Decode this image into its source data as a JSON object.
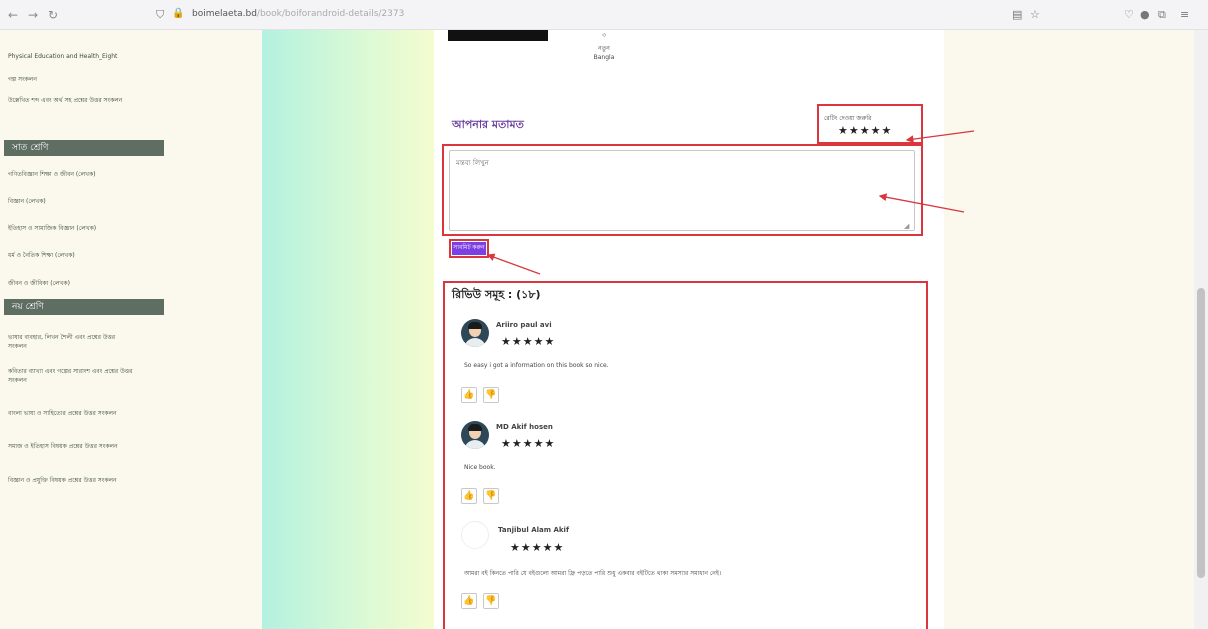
{
  "browser": {
    "back": "←",
    "forward": "→",
    "reload": "↻",
    "shield": "⛉",
    "lock": "🔒",
    "url_host": "boimelaeta.bd",
    "url_path": "/book/boiforandroid-details/2373",
    "reader_icon": "▤",
    "star_icon": "☆",
    "pocket_icon": "♡",
    "account_icon": "●",
    "extensions_icon": "⧉",
    "menu_icon": "≡"
  },
  "sidebar": {
    "items_top": [
      "Physical Education and Health_Eight",
      "গল্প সংকলন",
      "উল্লেখিত শব্দ এবং অর্থ সহ প্রশ্নের উত্তর সংকলন"
    ],
    "heading1": "সাত শ্রেণি",
    "items_mid": [
      "গণিতবিজ্ঞান শিক্ষা ও জীবন (লেখক)",
      "বিজ্ঞান (লেখক)",
      "ইতিহাস ও সামাজিক বিজ্ঞান (লেখক)",
      "ধর্ম ও নৈতিক শিক্ষা (লেখক)",
      "জীবন ও জীবিকা (লেখক)"
    ],
    "heading2": "নয় শ্রেণি",
    "items_bottom": [
      "ভাষার ব্যবহার, লিখন শৈলী এবং প্রশ্নের উত্তর সংকলন",
      "কবিতার ব্যাখ্যা এবং গল্পের সারাংশ এবং প্রশ্নের উত্তর সংকলন",
      "বাংলা ভাষা ও সাহিত্যের প্রশ্নের উত্তর সংকলন",
      "সমাজ ও ইতিহাস বিষয়ক প্রশ্নের উত্তর সংকলন",
      "বিজ্ঞান ও প্রযুক্তি বিষয়ক প্রশ্নের উত্তর সংকলন"
    ]
  },
  "book_meta": {
    "line1": "৩",
    "line2": "নতুন",
    "line3": "Bangla"
  },
  "review_form": {
    "title": "আপনার মতামত",
    "rate_label": "রেটিং দেওয়া জরুরি",
    "stars": "★★★★★",
    "placeholder": "মন্তব্য লিখুন",
    "resize_grip": "◢",
    "submit_label": "সাবমিট করুন"
  },
  "reviews": {
    "heading": "রিভিউ সমূহ : (১৮)",
    "thumb_up": "👍",
    "thumb_down": "👎",
    "items": [
      {
        "name": "Ariiro paul avi",
        "stars": "★★★★★",
        "text": "So easy i got a information on this book so nice."
      },
      {
        "name": "MD Akif hosen",
        "stars": "★★★★★",
        "text": "Nice book."
      },
      {
        "name": "Tanjibul Alam Akif",
        "stars": "★★★★★",
        "text": "আমরা বই কিনতে পারি যে বইগুলো আমরা ফ্রি পড়তে পারি শুধু একবার বইটিতে থাকা সমস্যার সমাধান নেই।"
      }
    ]
  },
  "colors": {
    "annotation_red": "#d9363e",
    "accent_purple": "#7b3fe4"
  }
}
